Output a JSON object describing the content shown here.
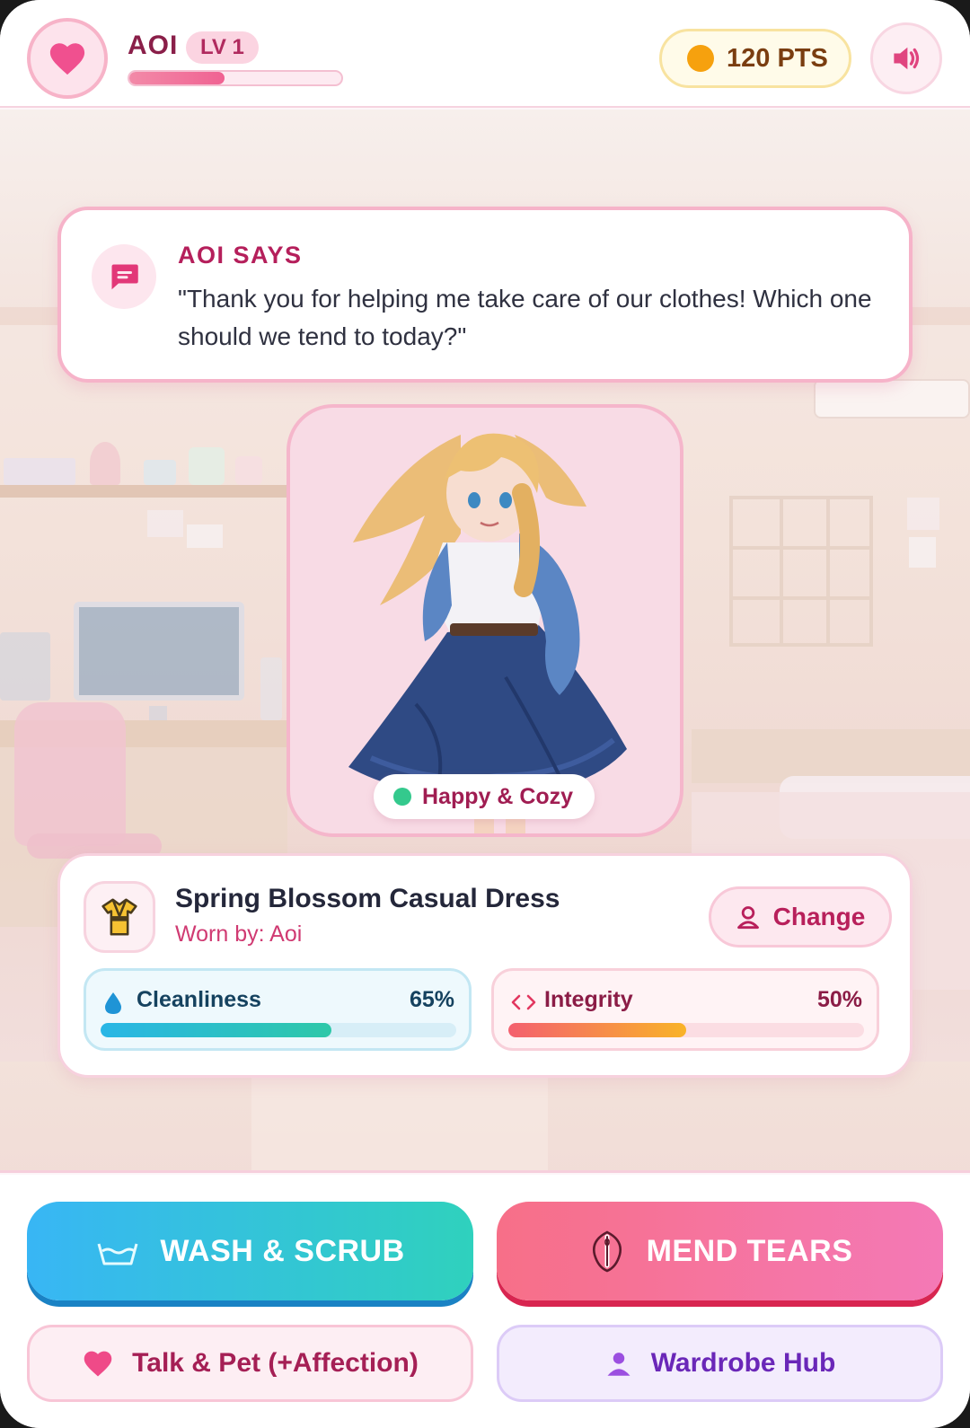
{
  "header": {
    "character_name": "AOI",
    "level_label": "LV 1",
    "xp_progress": 0.45,
    "points_label": "120 PTS"
  },
  "speech": {
    "title": "AOI SAYS",
    "text": "\"Thank you for helping me take care of our clothes! Which one should we tend to today?\""
  },
  "character": {
    "mood_label": "Happy & Cozy",
    "mood_color": "#34c98d"
  },
  "outfit": {
    "name": "Spring Blossom Casual Dress",
    "worn_by": "Worn by: Aoi",
    "change_label": "Change",
    "stats": {
      "cleanliness": {
        "label": "Cleanliness",
        "value_label": "65%",
        "value": 0.65
      },
      "integrity": {
        "label": "Integrity",
        "value_label": "50%",
        "value": 0.5
      }
    }
  },
  "actions": {
    "wash_label": "WASH & SCRUB",
    "mend_label": "MEND TEARS",
    "talk_label": "Talk & Pet (+Affection)",
    "wardrobe_label": "Wardrobe Hub"
  },
  "colors": {
    "accent_pink": "#f06292",
    "wash_start": "#38b6f5",
    "wash_end": "#2fd1bd",
    "mend_start": "#f76f88",
    "mend_end": "#f479b6"
  },
  "icons": {
    "avatar": "heart-icon",
    "points": "coin-icon",
    "sound": "speaker-icon",
    "speech": "chat-bubble-icon",
    "outfit": "kimono-icon",
    "change": "person-icon",
    "cleanliness": "water-drop-icon",
    "integrity": "code-brackets-icon",
    "wash": "wash-basin-icon",
    "mend": "needle-icon",
    "talk": "heart-icon",
    "wardrobe": "person-icon"
  }
}
